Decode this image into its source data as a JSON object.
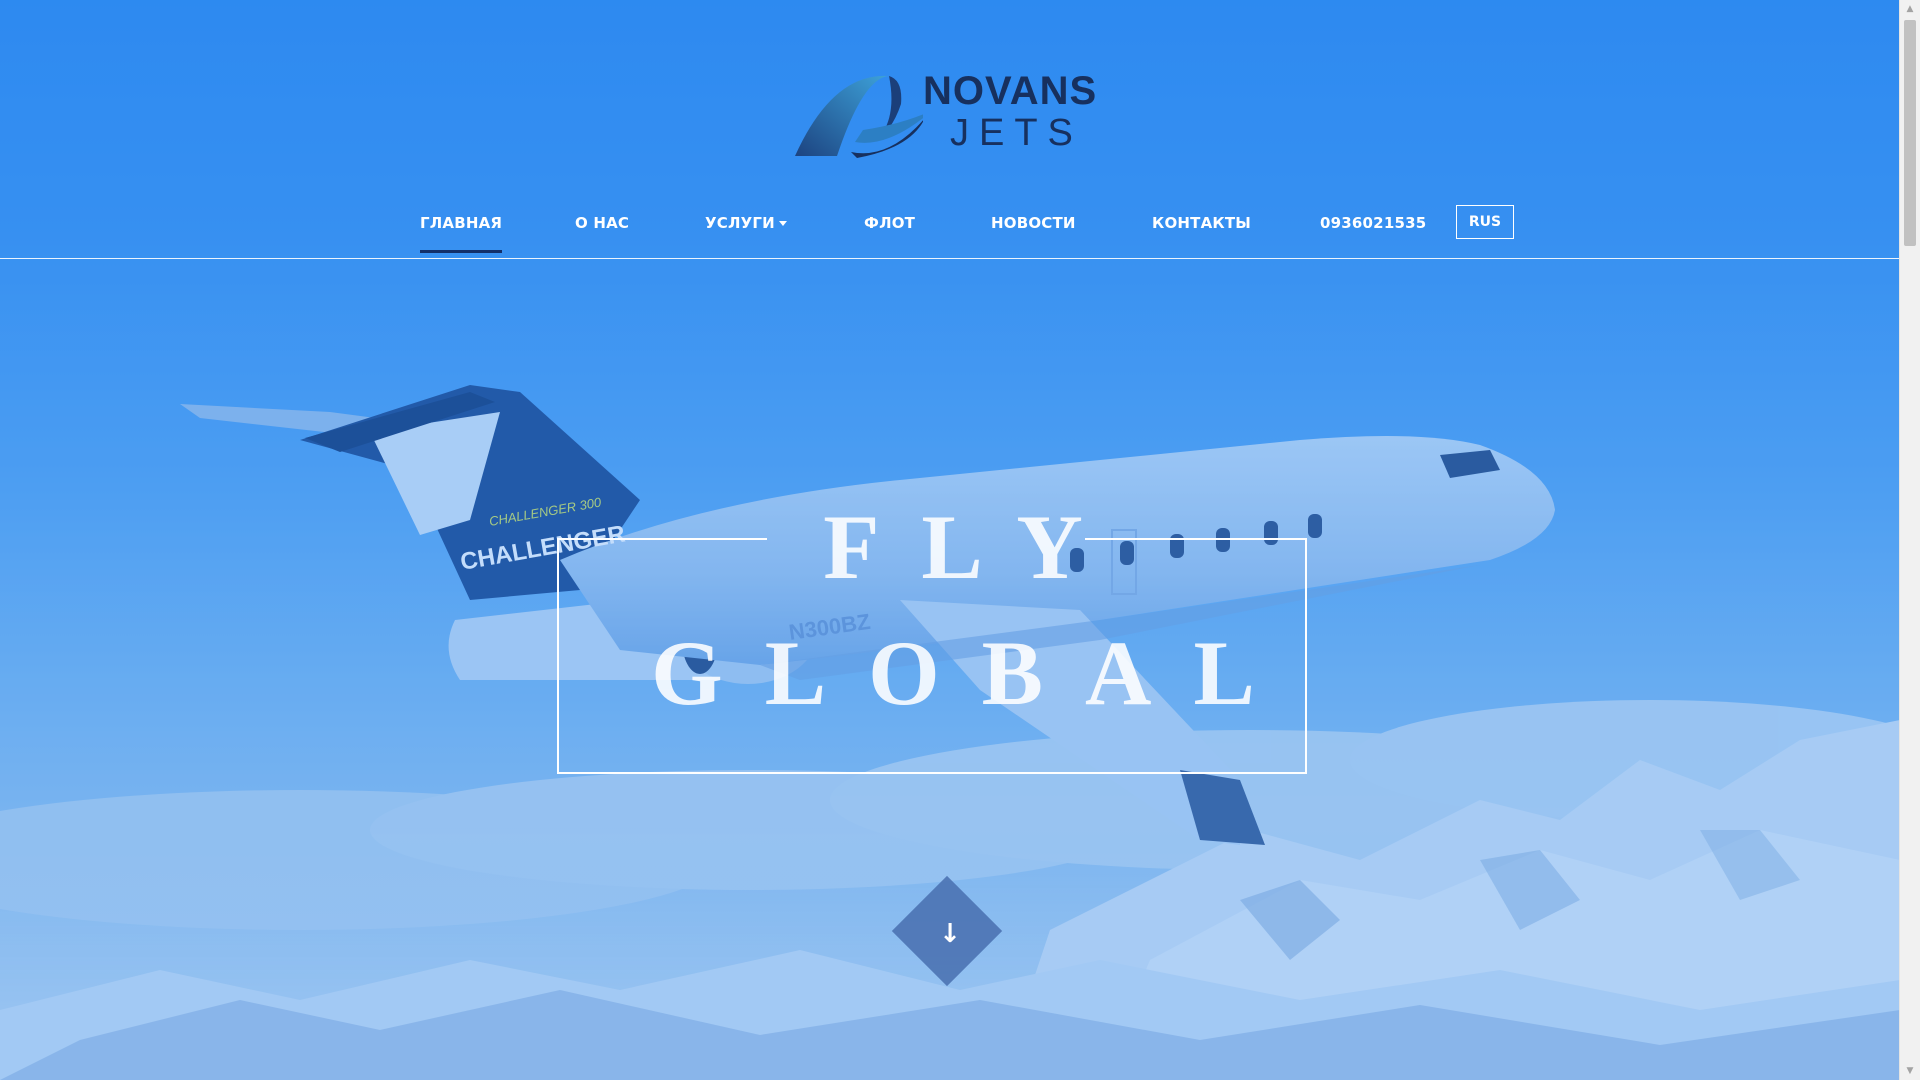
{
  "brand": {
    "name_line1": "NOVANS",
    "name_line2": "JETS",
    "primary_color": "#17305e",
    "accent_color": "#3ea3d8"
  },
  "nav": {
    "items": [
      {
        "label": "ГЛАВНАЯ",
        "active": true
      },
      {
        "label": "О НАС",
        "active": false
      },
      {
        "label": "УСЛУГИ",
        "active": false,
        "has_dropdown": true
      },
      {
        "label": "ФЛОТ",
        "active": false
      },
      {
        "label": "НОВОСТИ",
        "active": false
      },
      {
        "label": "КОНТАКТЫ",
        "active": false
      },
      {
        "label": "0936021535",
        "active": false
      }
    ],
    "language": "RUS"
  },
  "hero": {
    "line1": "FLY",
    "line2": "GLOBAL",
    "aircraft_tail_text": "CHALLENGER",
    "aircraft_registration": "N300BZ",
    "background_color": "#3c95f2"
  },
  "scroll_button": {
    "icon": "arrow-down-icon"
  }
}
